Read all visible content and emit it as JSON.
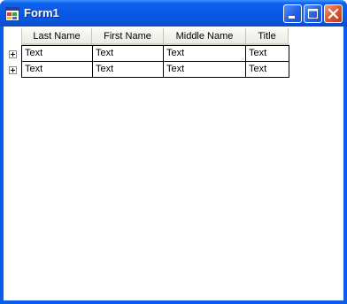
{
  "window": {
    "title": "Form1",
    "icon": "form-app-icon",
    "controls": [
      "minimize-icon",
      "maximize-icon",
      "close-icon"
    ]
  },
  "grid": {
    "columns": [
      "Last Name",
      "First Name",
      "Middle Name",
      "Title"
    ],
    "rows": [
      [
        "Text",
        "Text",
        "Text",
        "Text"
      ],
      [
        "Text",
        "Text",
        "Text",
        "Text"
      ]
    ]
  }
}
